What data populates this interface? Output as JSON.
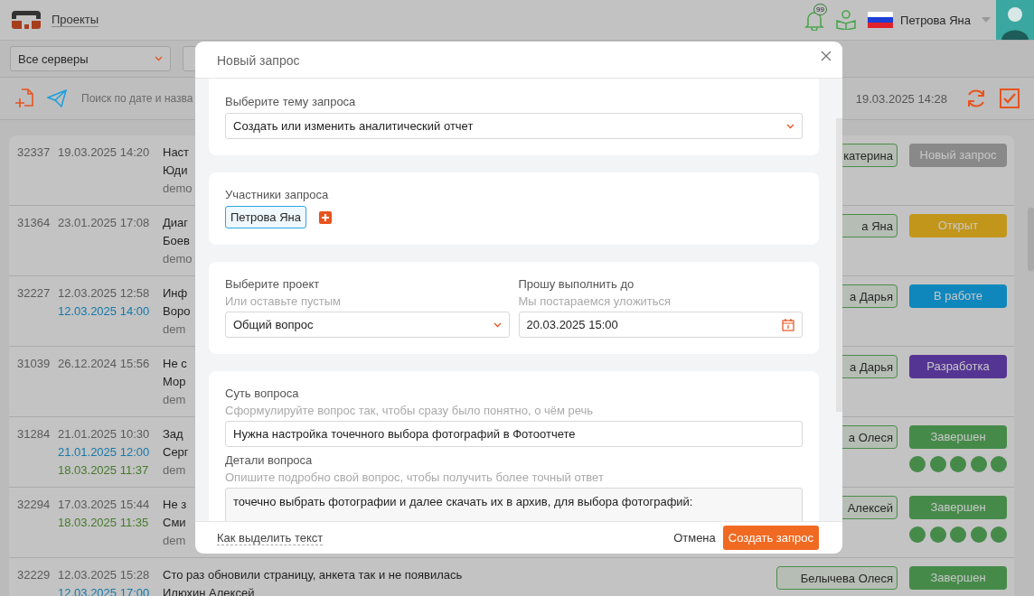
{
  "header": {
    "nav_link": "Проекты",
    "notifications_count": "99",
    "user_name": "Петрова Яна"
  },
  "filters": {
    "server_select": "Все серверы"
  },
  "toolbar": {
    "search_placeholder": "Поиск по дате и назва",
    "timestamp": "19.03.2025 14:28"
  },
  "requests": [
    {
      "id": "32337",
      "dates": [
        {
          "kind": "created",
          "text": "19.03.2025 14:20"
        }
      ],
      "lines": [
        "Наст",
        "Юди"
      ],
      "meta": "demo",
      "assignee": "катерина",
      "status": "Новый запрос",
      "color": "#898989"
    },
    {
      "id": "31364",
      "dates": [
        {
          "kind": "created",
          "text": "23.01.2025 17:08"
        }
      ],
      "lines": [
        "Диаг",
        "Боев"
      ],
      "meta": "demo",
      "assignee": "а Яна",
      "status": "Открыт",
      "color": "#c2961a"
    },
    {
      "id": "32227",
      "dates": [
        {
          "kind": "created",
          "text": "12.03.2025 12:58"
        },
        {
          "kind": "deadline",
          "text": "12.03.2025 14:00"
        }
      ],
      "lines": [
        "Инф",
        "Воро"
      ],
      "meta": "dem",
      "assignee": "а Дарья",
      "status": "В работе",
      "color": "#0f87bd"
    },
    {
      "id": "31039",
      "dates": [
        {
          "kind": "created",
          "text": "26.12.2024 15:56"
        }
      ],
      "lines": [
        "Не с",
        "Мор"
      ],
      "meta": "dem",
      "assignee": "а Дарья",
      "status": "Разработка",
      "color": "#553593"
    },
    {
      "id": "31284",
      "dates": [
        {
          "kind": "created",
          "text": "21.01.2025 10:30"
        },
        {
          "kind": "deadline",
          "text": "21.01.2025 12:00"
        },
        {
          "kind": "closed",
          "text": "18.03.2025 11:37"
        }
      ],
      "lines": [
        "Зад",
        "Серг"
      ],
      "meta": "dem",
      "assignee": "а Олеся",
      "status": "Завершен",
      "color": "#468a4a",
      "stars": 5
    },
    {
      "id": "32294",
      "dates": [
        {
          "kind": "created",
          "text": "17.03.2025 15:44"
        },
        {
          "kind": "closed",
          "text": "18.03.2025 11:35"
        }
      ],
      "lines": [
        "Не з",
        "Сми"
      ],
      "meta": "dem",
      "assignee": "Алексей",
      "status": "Завершен",
      "color": "#468a4a",
      "stars": 5
    },
    {
      "id": "32229",
      "dates": [
        {
          "kind": "created",
          "text": "12.03.2025 15:28"
        },
        {
          "kind": "deadline",
          "text": "12.03.2025 17:00"
        }
      ],
      "lines": [
        "Сто раз обновили страницу, анкета так и не появилась",
        "Илюхин Алексей"
      ],
      "assignee": "Белычева Олеся",
      "status": "Завершен",
      "color": "#468a4a"
    }
  ],
  "dialog": {
    "title": "Новый запрос",
    "topic": {
      "label": "Выберите тему запроса",
      "value": "Создать или изменить аналитический отчет"
    },
    "participants": {
      "label": "Участники запроса",
      "people": [
        "Петрова Яна"
      ]
    },
    "project": {
      "label": "Выберите проект",
      "hint": "Или оставьте пустым",
      "value": "Общий вопрос"
    },
    "deadline": {
      "label": "Прошу выполнить до",
      "hint": "Мы постараемся уложиться",
      "value": "20.03.2025 15:00"
    },
    "summary": {
      "label": "Суть вопроса",
      "hint": "Сформулируйте вопрос так, чтобы сразу было понятно, о чём речь",
      "value": "Нужна настройка точечного выбора фотографий в Фотоотчете"
    },
    "details": {
      "label": "Детали вопроса",
      "hint": "Опишите подробно свой вопрос, чтобы получить более точный ответ",
      "value": "точечно выбрать фотографии и далее скачать их в архив, для выбора фотографий:"
    },
    "help_link": "Как выделить текст",
    "cancel": "Отмена",
    "submit": "Создать запрос"
  }
}
